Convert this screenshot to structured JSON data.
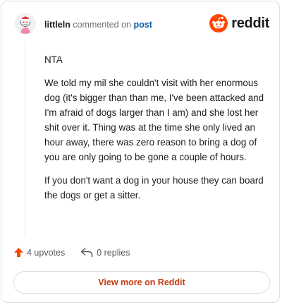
{
  "header": {
    "username": "littleln",
    "commented_text": "commented on",
    "post_link": "post",
    "brand_name": "reddit",
    "avatar_icon": "snoo-avatar-icon",
    "brand_icon": "reddit-snoo-icon"
  },
  "comment": {
    "paragraphs": [
      "NTA",
      "We told my mil she couldn't visit with her enormous dog (it's bigger than than me, I've been attacked and I'm afraid of dogs larger than I am) and she lost her shit over it. Thing was at the time she only lived an hour away, there was zero reason to bring a dog of you are only going to be gone a couple of hours.",
      "If you don't want a dog in your house they can board the dogs or get a sitter."
    ]
  },
  "actions": {
    "upvotes": "4 upvotes",
    "replies": "0 replies",
    "upvote_icon": "upvote-arrow-icon",
    "reply_icon": "reply-arrow-icon"
  },
  "footer": {
    "view_more": "View more on Reddit"
  },
  "colors": {
    "brand_orange": "#ff4500",
    "link_blue": "#0b5aa6",
    "view_more_red": "#c23a12",
    "border": "#dcdfe3"
  }
}
